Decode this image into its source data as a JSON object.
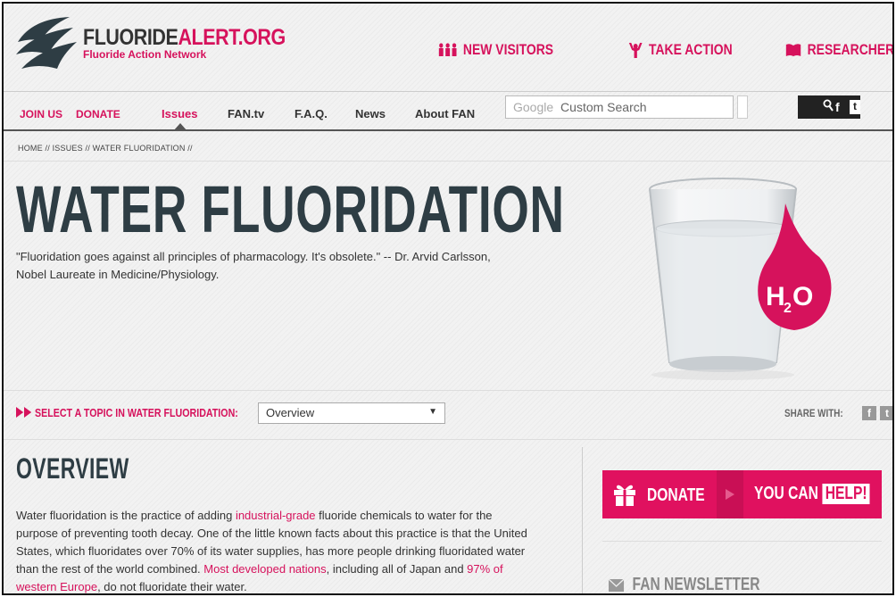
{
  "logo": {
    "title_a": "FLUORIDE",
    "title_b": "ALERT.ORG",
    "subtitle": "Fluoride Action Network"
  },
  "topnav": {
    "new_visitors": "NEW VISITORS",
    "take_action": "TAKE ACTION",
    "researchers": "RESEARCHERS"
  },
  "mainnav": {
    "join_us": "JOIN US",
    "donate": "DONATE",
    "items": [
      "Issues",
      "FAN.tv",
      "F.A.Q.",
      "News",
      "About FAN"
    ]
  },
  "search": {
    "brand": "Google",
    "placeholder": "Custom Search"
  },
  "breadcrumb": "HOME  //  ISSUES  //  WATER FLUORIDATION  //",
  "hero": {
    "title": "WATER FLUORIDATION",
    "quote": "\"Fluoridation goes against all principles of pharmacology. It's obsolete.\" -- Dr. Arvid Carlsson, Nobel Laureate in Medicine/Physiology.",
    "drop_label": "H",
    "drop_sub": "2",
    "drop_tail": "O"
  },
  "topic": {
    "label": "SELECT A TOPIC IN WATER FLUORIDATION:",
    "selected": "Overview"
  },
  "share": {
    "label": "SHARE WITH:",
    "fb": "f",
    "tw": "t"
  },
  "overview": {
    "heading": "OVERVIEW",
    "p1_a": "Water fluoridation is the practice of adding ",
    "p1_link1": "industrial-grade",
    "p1_b": " fluoride chemicals to water for the purpose of preventing tooth decay. One of the little known facts about this practice is that the United States, which fluoridates over 70% of its water supplies, has more people drinking fluoridated water than the rest of the world combined. ",
    "p1_link2": "Most developed nations",
    "p1_c": ", including all of Japan and ",
    "p1_link3": "97% of western Europe",
    "p1_d": ", do not fluoridate their water."
  },
  "sidebar": {
    "donate": "DONATE",
    "you_can": "YOU CAN",
    "help": "HELP!",
    "newsletter": "FAN NEWSLETTER"
  },
  "colors": {
    "accent": "#d6125c",
    "dark": "#2e3d44"
  }
}
